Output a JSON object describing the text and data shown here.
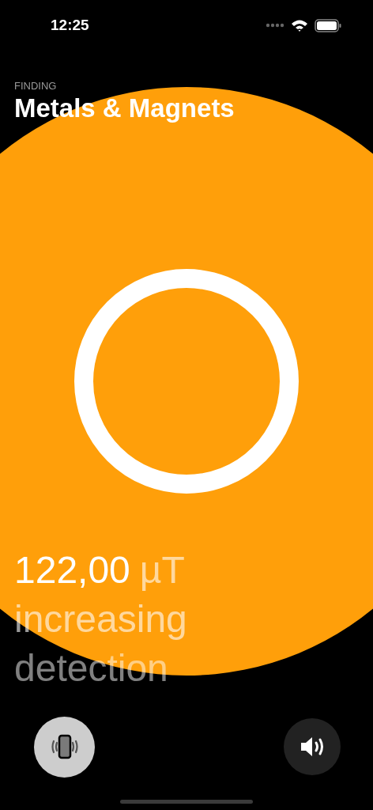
{
  "status_bar": {
    "time": "12:25"
  },
  "header": {
    "eyebrow": "FINDING",
    "title": "Metals & Magnets"
  },
  "reading": {
    "value": "122,00",
    "unit": "µT",
    "trend": "increasing",
    "label": "detection"
  },
  "controls": [
    {
      "kind": "vibration",
      "on": true
    },
    {
      "kind": "sound",
      "on": false
    }
  ]
}
